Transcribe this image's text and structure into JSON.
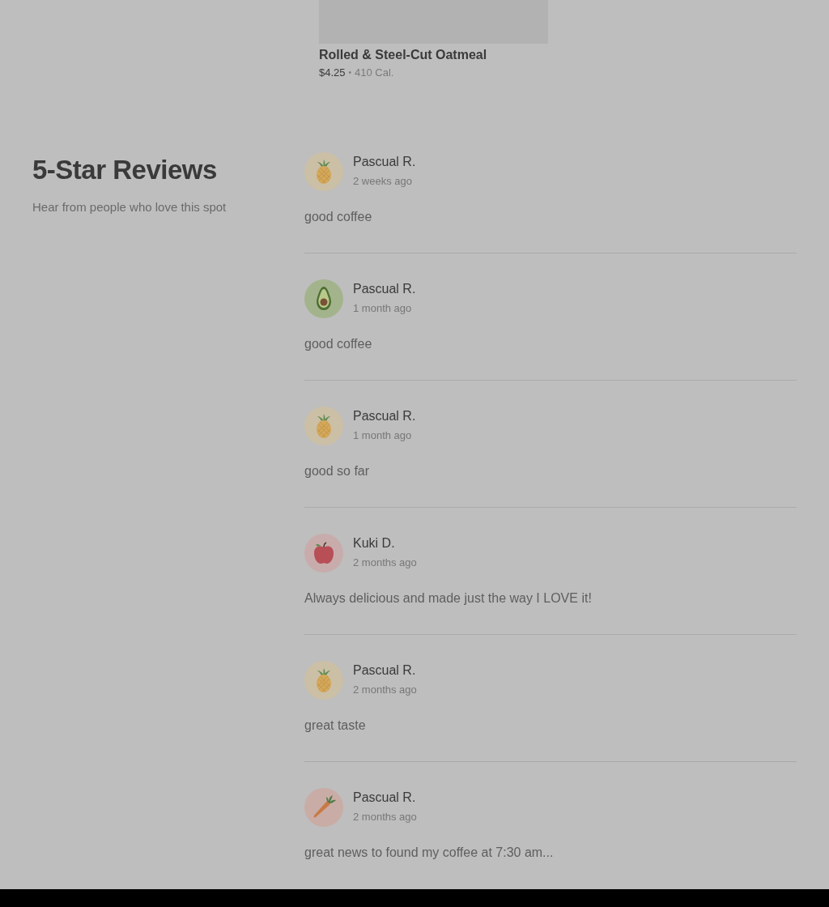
{
  "menu_item": {
    "title": "Rolled & Steel-Cut Oatmeal",
    "price": "$4.25",
    "separator": "•",
    "calories": "410 Cal."
  },
  "reviews_section": {
    "title": "5-Star Reviews",
    "subtitle": "Hear from people who love this spot"
  },
  "reviews": [
    {
      "kind": "pineapple",
      "name": "Pascual R.",
      "date": "2 weeks ago",
      "text": "good coffee"
    },
    {
      "kind": "avocado",
      "name": "Pascual R.",
      "date": "1 month ago",
      "text": "good coffee"
    },
    {
      "kind": "pineapple",
      "name": "Pascual R.",
      "date": "1 month ago",
      "text": "good so far"
    },
    {
      "kind": "apple",
      "name": "Kuki D.",
      "date": "2 months ago",
      "text": "Always delicious and made just the way I LOVE it!"
    },
    {
      "kind": "pineapple",
      "name": "Pascual R.",
      "date": "2 months ago",
      "text": "great taste"
    },
    {
      "kind": "carrot",
      "name": "Pascual R.",
      "date": "2 months ago",
      "text": "great news to found my coffee at 7:30 am..."
    }
  ]
}
